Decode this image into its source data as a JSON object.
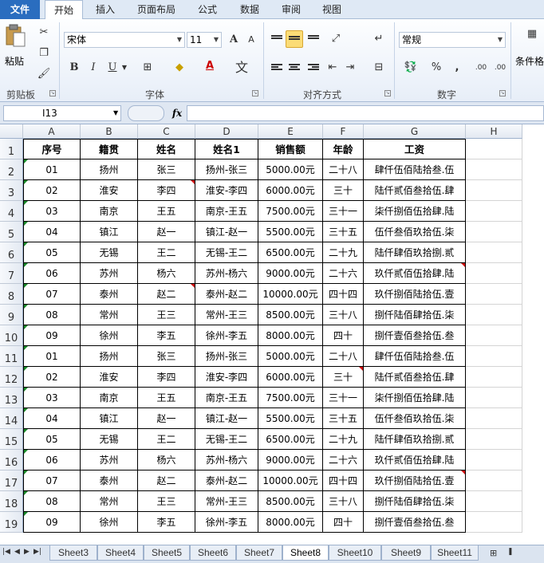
{
  "tabs": [
    "文件",
    "开始",
    "插入",
    "页面布局",
    "公式",
    "数据",
    "审阅",
    "视图"
  ],
  "ribbon": {
    "clipboard": {
      "paste_label": "粘贴",
      "group_label": "剪贴板"
    },
    "font": {
      "font_name": "宋体",
      "font_size": "11",
      "group_label": "字体",
      "bold": "B",
      "italic": "I",
      "underline": "U",
      "grow": "A",
      "shrink": "A",
      "font_color": "A",
      "phonetic": "文"
    },
    "alignment": {
      "group_label": "对齐方式"
    },
    "number": {
      "format": "常规",
      "group_label": "数字",
      "percent": "%",
      "comma": ",",
      "inc_decimal": ".00",
      "dec_decimal": ".00"
    },
    "styles": {
      "cond_format_label": "条件格"
    }
  },
  "formula_bar": {
    "name_box": "I13",
    "fx_label": "fx",
    "formula": ""
  },
  "columns": [
    "A",
    "B",
    "C",
    "D",
    "E",
    "F",
    "G",
    "H"
  ],
  "rows": [
    {
      "n": "1",
      "cells": [
        "序号",
        "籍贯",
        "姓名",
        "姓名1",
        "销售额",
        "年龄",
        "工资"
      ]
    },
    {
      "n": "2",
      "cells": [
        "01",
        "扬州",
        "张三",
        "扬州-张三",
        "5000.00元",
        "二十八",
        "肆仟伍佰陆拾叁.伍"
      ]
    },
    {
      "n": "3",
      "cells": [
        "02",
        "淮安",
        "李四",
        "淮安-李四",
        "6000.00元",
        "三十",
        "陆仟贰佰叁拾伍.肆"
      ]
    },
    {
      "n": "4",
      "cells": [
        "03",
        "南京",
        "王五",
        "南京-王五",
        "7500.00元",
        "三十一",
        "柒仟捌佰伍拾肆.陆"
      ]
    },
    {
      "n": "5",
      "cells": [
        "04",
        "镇江",
        "赵一",
        "镇江-赵一",
        "5500.00元",
        "三十五",
        "伍仟叁佰玖拾伍.柒"
      ]
    },
    {
      "n": "6",
      "cells": [
        "05",
        "无锡",
        "王二",
        "无锡-王二",
        "6500.00元",
        "二十九",
        "陆仟肆佰玖拾捌.贰"
      ]
    },
    {
      "n": "7",
      "cells": [
        "06",
        "苏州",
        "杨六",
        "苏州-杨六",
        "9000.00元",
        "二十六",
        "玖仟贰佰伍拾肆.陆"
      ]
    },
    {
      "n": "8",
      "cells": [
        "07",
        "泰州",
        "赵二",
        "泰州-赵二",
        "10000.00元",
        "四十四",
        "玖仟捌佰陆拾伍.壹"
      ]
    },
    {
      "n": "9",
      "cells": [
        "08",
        "常州",
        "王三",
        "常州-王三",
        "8500.00元",
        "三十八",
        "捌仟陆佰肆拾伍.柒"
      ]
    },
    {
      "n": "10",
      "cells": [
        "09",
        "徐州",
        "李五",
        "徐州-李五",
        "8000.00元",
        "四十",
        "捌仟壹佰叁拾伍.叁"
      ]
    },
    {
      "n": "11",
      "cells": [
        "01",
        "扬州",
        "张三",
        "扬州-张三",
        "5000.00元",
        "二十八",
        "肆仟伍佰陆拾叁.伍"
      ]
    },
    {
      "n": "12",
      "cells": [
        "02",
        "淮安",
        "李四",
        "淮安-李四",
        "6000.00元",
        "三十",
        "陆仟贰佰叁拾伍.肆"
      ]
    },
    {
      "n": "13",
      "cells": [
        "03",
        "南京",
        "王五",
        "南京-王五",
        "7500.00元",
        "三十一",
        "柒仟捌佰伍拾肆.陆"
      ]
    },
    {
      "n": "14",
      "cells": [
        "04",
        "镇江",
        "赵一",
        "镇江-赵一",
        "5500.00元",
        "三十五",
        "伍仟叁佰玖拾伍.柒"
      ]
    },
    {
      "n": "15",
      "cells": [
        "05",
        "无锡",
        "王二",
        "无锡-王二",
        "6500.00元",
        "二十九",
        "陆仟肆佰玖拾捌.贰"
      ]
    },
    {
      "n": "16",
      "cells": [
        "06",
        "苏州",
        "杨六",
        "苏州-杨六",
        "9000.00元",
        "二十六",
        "玖仟贰佰伍拾肆.陆"
      ]
    },
    {
      "n": "17",
      "cells": [
        "07",
        "泰州",
        "赵二",
        "泰州-赵二",
        "10000.00元",
        "四十四",
        "玖仟捌佰陆拾伍.壹"
      ]
    },
    {
      "n": "18",
      "cells": [
        "08",
        "常州",
        "王三",
        "常州-王三",
        "8500.00元",
        "三十八",
        "捌仟陆佰肆拾伍.柒"
      ]
    },
    {
      "n": "19",
      "cells": [
        "09",
        "徐州",
        "李五",
        "徐州-李五",
        "8000.00元",
        "四十",
        "捌仟壹佰叁拾伍.叁"
      ]
    }
  ],
  "sheets": [
    "Sheet3",
    "Sheet4",
    "Sheet5",
    "Sheet6",
    "Sheet7",
    "Sheet8",
    "Sheet10",
    "Sheet9",
    "Sheet11"
  ],
  "active_sheet": "Sheet8",
  "colors": {
    "file_tab": "#2a6dbf",
    "green_indicator": "#1a8a2a",
    "red_indicator": "#d01010",
    "highlight": "#fbdc76"
  }
}
